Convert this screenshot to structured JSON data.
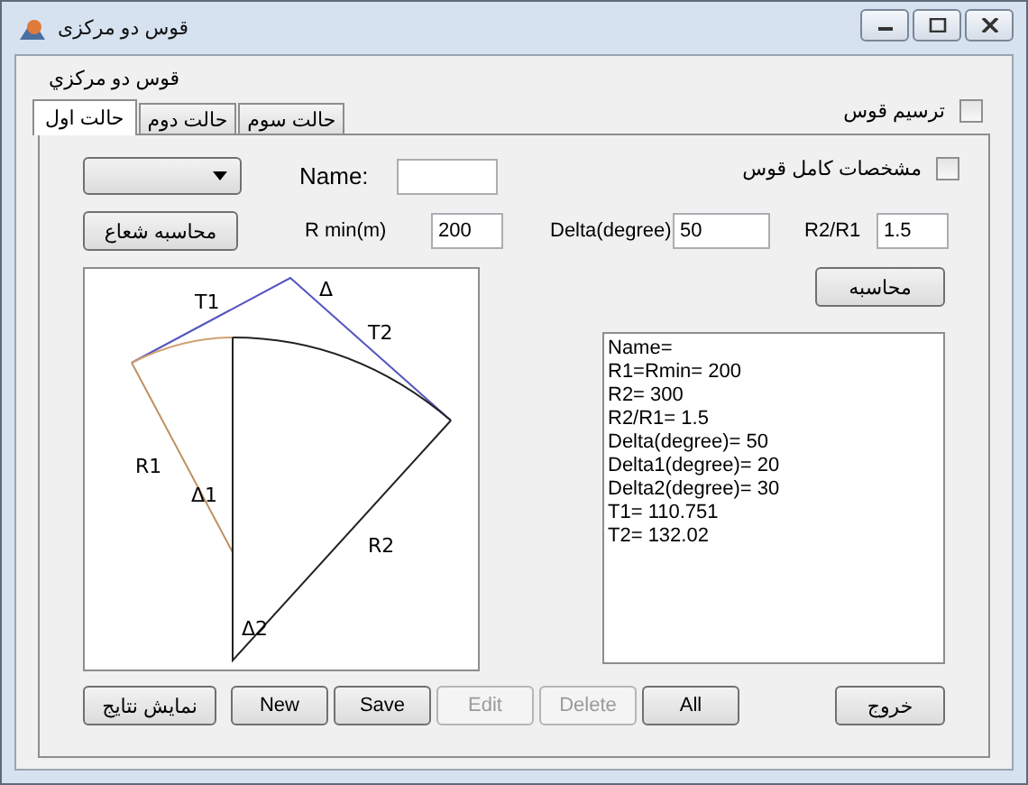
{
  "window": {
    "title": "قوس دو مرکزی"
  },
  "header_label": "قوس دو مرکزي",
  "draw_arc": {
    "label": "ترسیم قوس",
    "checked": false
  },
  "tabs": [
    {
      "label": "حالت سوم",
      "selected": false
    },
    {
      "label": "حالت دوم",
      "selected": false
    },
    {
      "label": "حالت اول",
      "selected": true
    }
  ],
  "name_field": {
    "label": "Name:"
  },
  "full_specs": {
    "label": "مشخصات کامل قوس",
    "checked": false
  },
  "radius_button": "محاسبه شعاع",
  "fields": [
    {
      "label": "R2/R1",
      "value": "1.5"
    },
    {
      "label": "Delta(degree)",
      "value": "50"
    },
    {
      "label": "R min(m)",
      "value": "200"
    }
  ],
  "calculate_button": "محاسبه",
  "diagram_labels": [
    "T1",
    "Δ",
    "T2",
    "R1",
    "Δ1",
    "R2",
    "Δ2"
  ],
  "results": [
    "Name=",
    "R1=Rmin=  200",
    "R2=  300",
    "R2/R1=  1.5",
    "Delta(degree)=  50",
    "Delta1(degree)=  20",
    "Delta2(degree)=  30",
    "T1=  110.751",
    "T2=  132.02"
  ],
  "show_results_button": "نمایش نتایج",
  "buttons": [
    {
      "label": "All",
      "disabled": false
    },
    {
      "label": "Delete",
      "disabled": true
    },
    {
      "label": "Edit",
      "disabled": true
    },
    {
      "label": "Save",
      "disabled": false
    },
    {
      "label": "New",
      "disabled": false
    }
  ],
  "exit_button": "خروج"
}
